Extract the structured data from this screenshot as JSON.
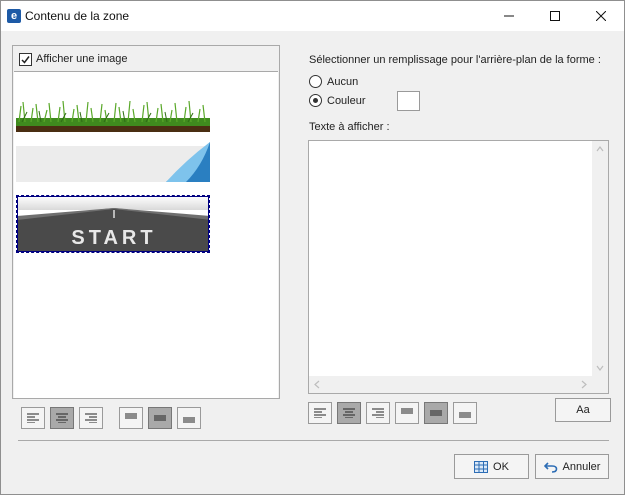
{
  "window": {
    "title": "Contenu de la zone",
    "app_icon": "e",
    "controls": [
      "minimize-icon",
      "maximize-icon",
      "close-icon"
    ]
  },
  "image_panel": {
    "show_image_label": "Afficher une image",
    "show_image_checked": true,
    "images": [
      {
        "name": "grass-banner",
        "selected": false
      },
      {
        "name": "page-curl-banner",
        "selected": false
      },
      {
        "name": "start-road-banner",
        "selected": true
      }
    ],
    "road_text": "START",
    "alignment_selected": [
      "center",
      "middle"
    ]
  },
  "fill_panel": {
    "label": "Sélectionner un remplissage pour l'arrière-plan de la forme :",
    "options": [
      {
        "label": "Aucun",
        "checked": false
      },
      {
        "label": "Couleur",
        "checked": true
      }
    ],
    "swatch_color": "#ffffff"
  },
  "text_panel": {
    "label": "Texte à afficher :",
    "value": "",
    "alignment_selected": [
      "center",
      "middle"
    ],
    "font_button_label": "Aa"
  },
  "footer": {
    "ok_label": "OK",
    "cancel_label": "Annuler"
  }
}
